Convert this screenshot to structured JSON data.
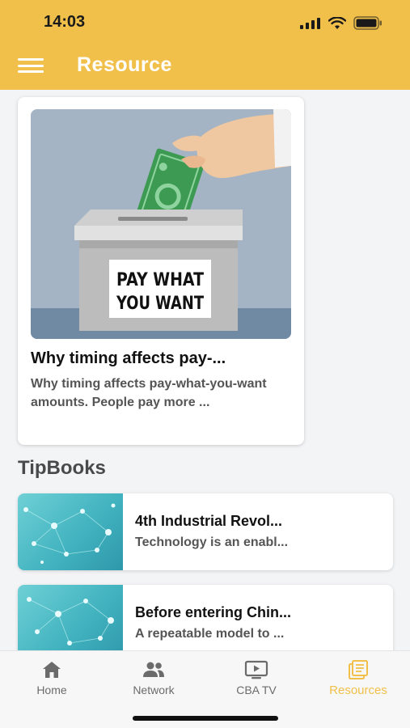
{
  "status_bar": {
    "time": "14:03",
    "icons": [
      "cellular-signal-icon",
      "wifi-icon",
      "battery-icon"
    ]
  },
  "header": {
    "title": "Resource",
    "menu_icon": "hamburger-menu-icon"
  },
  "featured": {
    "image_sign_line1": "PAY WHAT",
    "image_sign_line2": "YOU WANT",
    "title": "Why timing affects pay-...",
    "description": "Why timing affects pay-what-you-want amounts. People pay more ..."
  },
  "section": {
    "title": "TipBooks"
  },
  "tipbooks": [
    {
      "title": "4th Industrial Revol...",
      "description": "Technology is an enabl..."
    },
    {
      "title": "Before entering Chin...",
      "description": "A repeatable model to ..."
    }
  ],
  "bottom_nav": [
    {
      "label": "Home",
      "icon": "home-icon",
      "active": false
    },
    {
      "label": "Network",
      "icon": "people-icon",
      "active": false
    },
    {
      "label": "CBA TV",
      "icon": "tv-play-icon",
      "active": false
    },
    {
      "label": "Resources",
      "icon": "resources-icon",
      "active": true
    }
  ],
  "colors": {
    "accent": "#f1c04a",
    "background": "#f3f4f6",
    "nav_inactive": "#6b6b6b"
  }
}
